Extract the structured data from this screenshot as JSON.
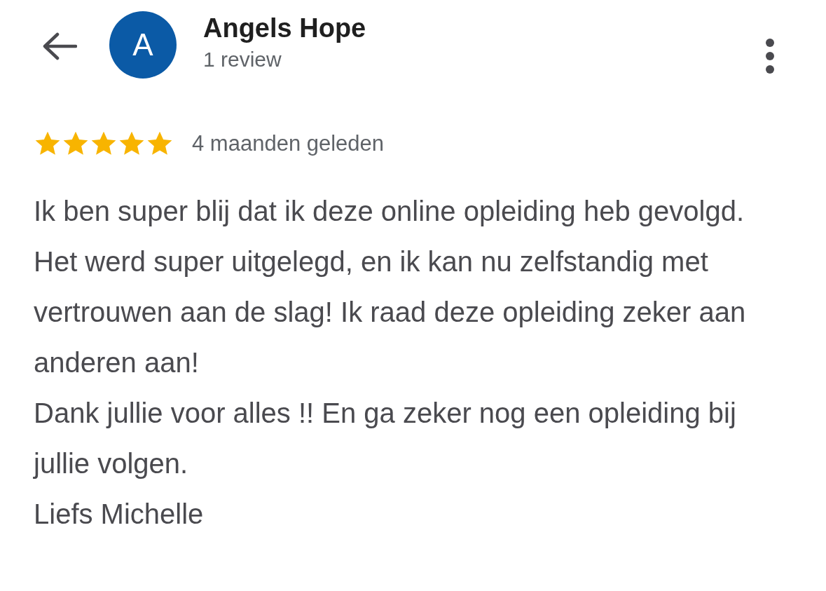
{
  "header": {
    "avatar_letter": "A",
    "name": "Angels Hope",
    "subtitle": "1 review"
  },
  "review": {
    "stars": 5,
    "time": "4 maanden geleden",
    "text": "Ik ben super blij dat ik deze online opleiding heb gevolgd.\nHet werd super uitgelegd, en ik kan nu zelfstandig met vertrouwen aan de slag! Ik raad deze opleiding zeker aan anderen aan!\nDank jullie voor alles !! En ga zeker nog een opleiding bij jullie volgen.\nLiefs Michelle"
  }
}
